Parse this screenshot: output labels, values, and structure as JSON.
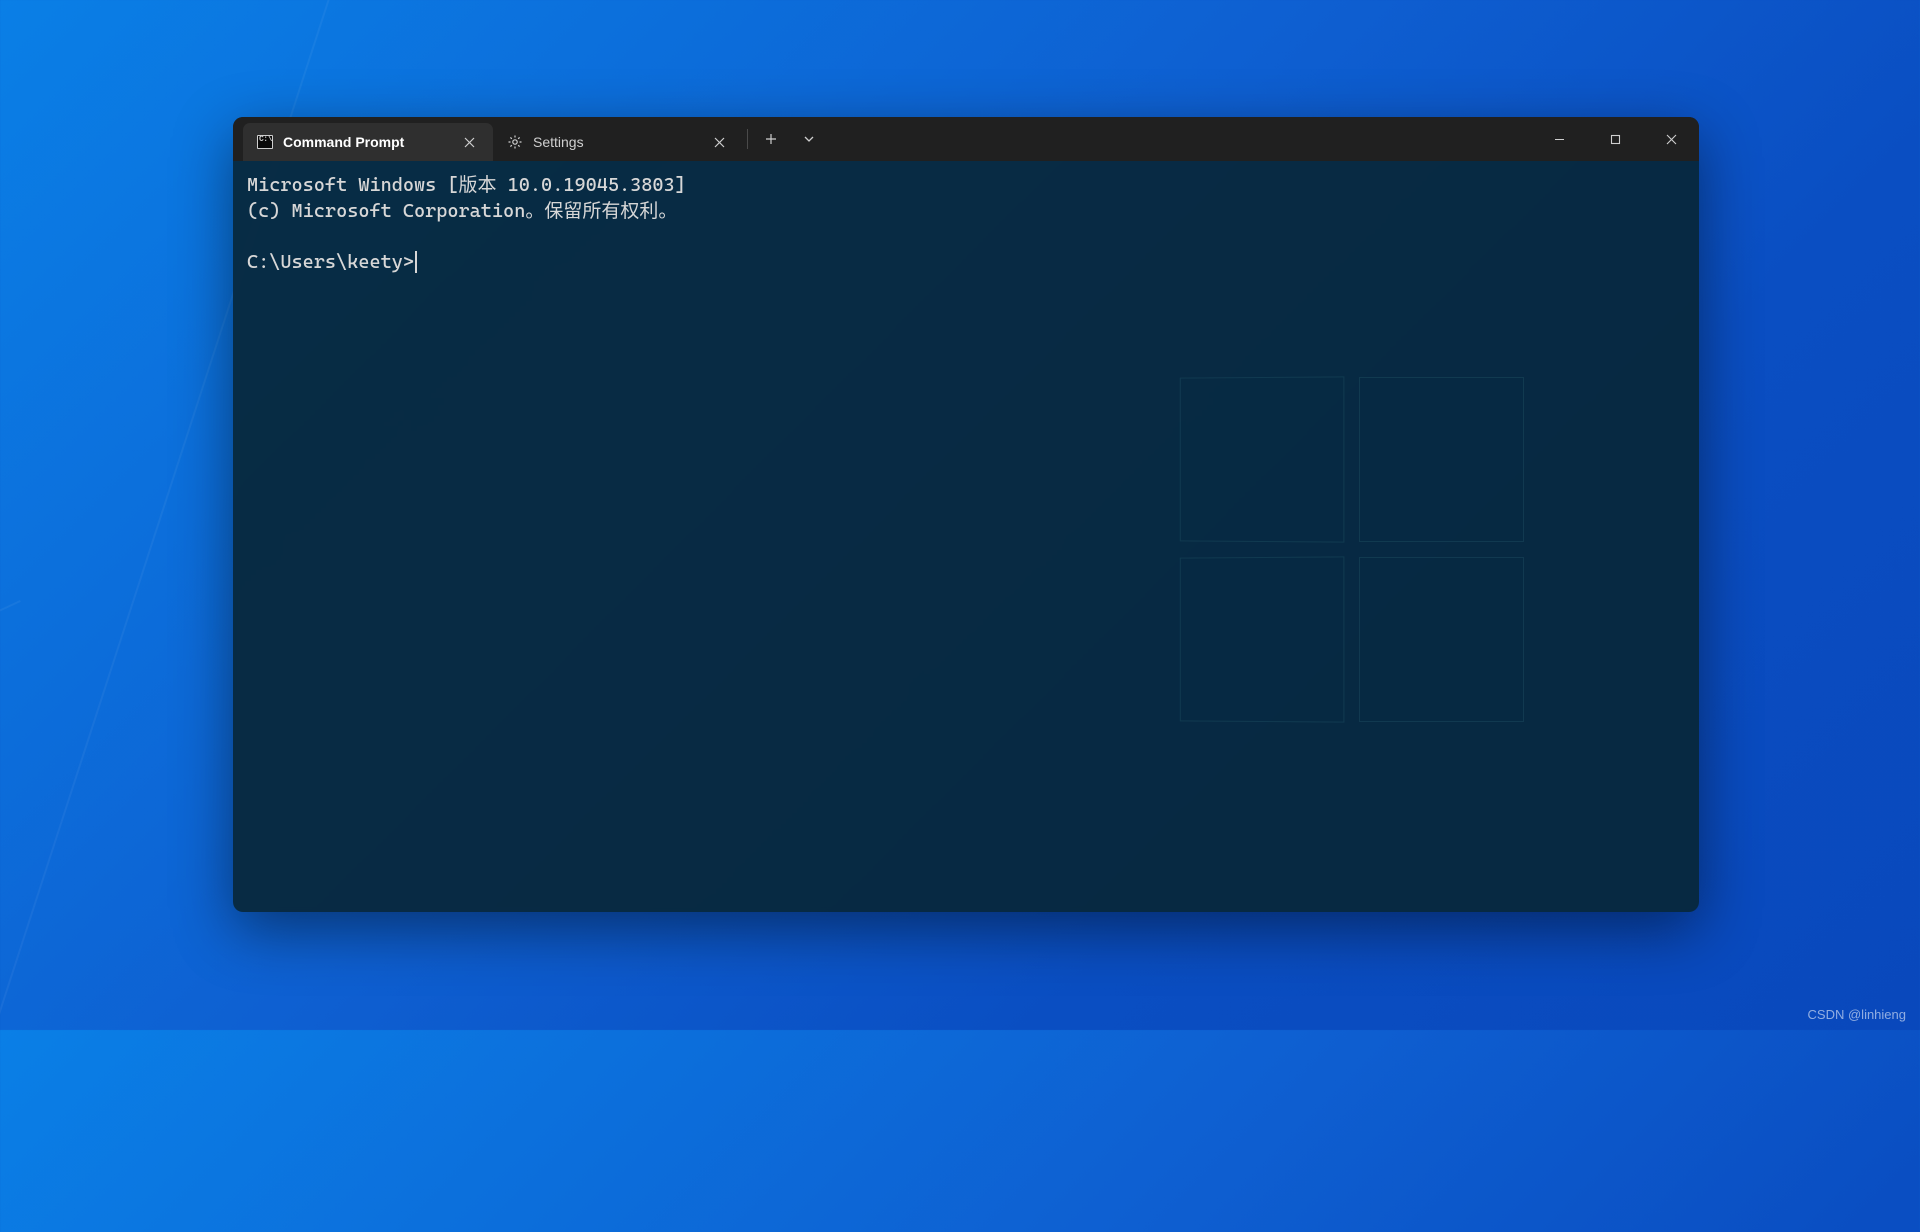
{
  "tabs": [
    {
      "label": "Command Prompt",
      "icon": "cmd-icon"
    },
    {
      "label": "Settings",
      "icon": "settings-icon"
    }
  ],
  "terminal": {
    "line1": "Microsoft Windows [版本 10.0.19045.3803]",
    "line2": "(c) Microsoft Corporation。保留所有权利。",
    "prompt": "C:\\Users\\keety>"
  },
  "watermark": "CSDN @linhieng"
}
